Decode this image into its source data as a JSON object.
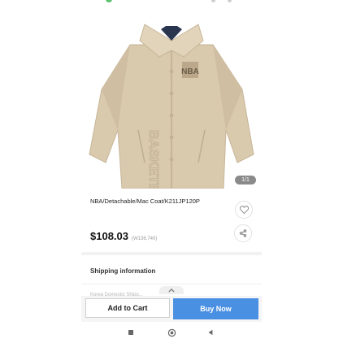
{
  "product": {
    "title": "NBA/Detachable/Mac Coat/K211JP120P",
    "price_usd": "$108.03",
    "price_krw": "(W136,740)",
    "image_counter": "1/1",
    "garment_print": "BASKETBALL",
    "garment_logo": "NBA"
  },
  "sections": {
    "shipping_label": "Shipping information",
    "partial_text": "Korea Domestic Shipp..."
  },
  "actions": {
    "add_to_cart": "Add to Cart",
    "buy_now": "Buy Now"
  },
  "colors": {
    "buy_now": "#4a90e2",
    "coat": "#d9c9ad"
  },
  "icons": [
    "wishlist-heart-icon",
    "share-icon",
    "chevron-up-icon",
    "recents-icon",
    "home-icon",
    "back-icon"
  ]
}
